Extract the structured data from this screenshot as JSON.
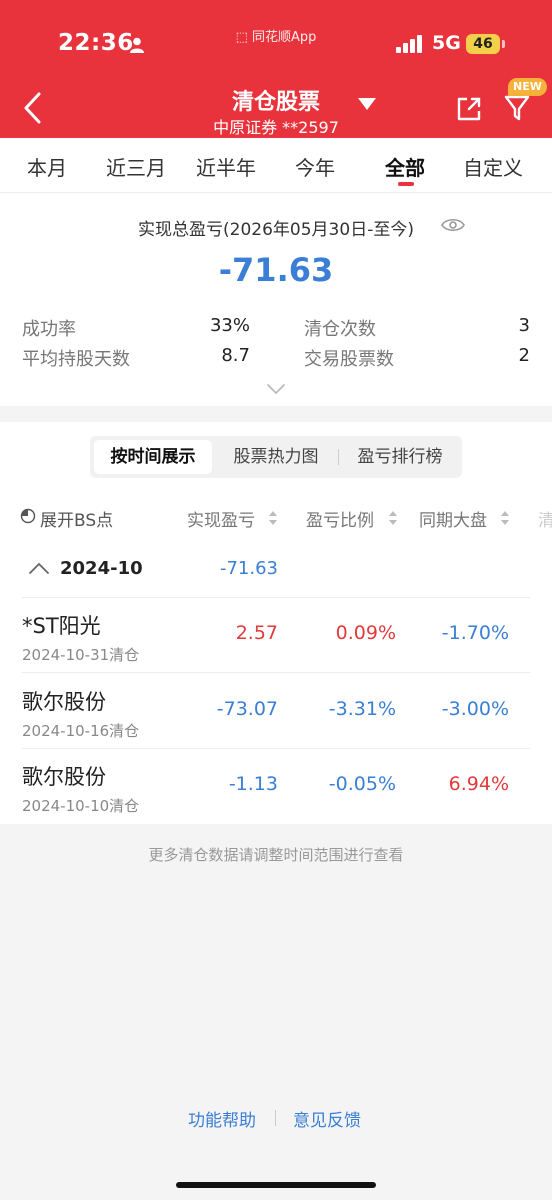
{
  "status_bar": {
    "time": "22:36",
    "carrier": "同花顺App",
    "network": "5G",
    "battery": "46"
  },
  "header": {
    "title": "清仓股票",
    "subtitle": "中原证券 **2597",
    "new_badge": "NEW"
  },
  "period_tabs": [
    {
      "label": "本月"
    },
    {
      "label": "近三月"
    },
    {
      "label": "近半年"
    },
    {
      "label": "今年"
    },
    {
      "label": "全部",
      "active": true
    },
    {
      "label": "自定义"
    }
  ],
  "summary": {
    "title": "实现总盈亏(2026年05月30日-至今)",
    "total_pl": "-71.63",
    "stats": [
      {
        "label": "成功率",
        "value": "33%"
      },
      {
        "label": "清仓次数",
        "value": "3"
      },
      {
        "label": "平均持股天数",
        "value": "8.7"
      },
      {
        "label": "交易股票数",
        "value": "2"
      }
    ]
  },
  "view_tabs": [
    {
      "label": "按时间展示",
      "active": true
    },
    {
      "label": "股票热力图"
    },
    {
      "label": "盈亏排行榜"
    }
  ],
  "columns": {
    "bs": "展开BS点",
    "realized": "实现盈亏",
    "ratio": "盈亏比例",
    "market": "同期大盘",
    "extra": "清"
  },
  "group": {
    "label": "2024-10",
    "pl": "-71.63"
  },
  "rows": [
    {
      "name": "*ST阳光",
      "date": "2024-10-31清仓",
      "pl": "2.57",
      "ratio": "0.09%",
      "market": "-1.70%",
      "pl_color": "red",
      "ratio_color": "red",
      "market_color": "blue"
    },
    {
      "name": "歌尔股份",
      "date": "2024-10-16清仓",
      "pl": "-73.07",
      "ratio": "-3.31%",
      "market": "-3.00%",
      "pl_color": "blue",
      "ratio_color": "blue",
      "market_color": "blue"
    },
    {
      "name": "歌尔股份",
      "date": "2024-10-10清仓",
      "pl": "-1.13",
      "ratio": "-0.05%",
      "market": "6.94%",
      "pl_color": "blue",
      "ratio_color": "blue",
      "market_color": "red"
    }
  ],
  "footer": {
    "note": "更多清仓数据请调整时间范围进行查看",
    "help": "功能帮助",
    "feedback": "意见反馈"
  },
  "colors": {
    "brand_red": "#e8333c",
    "gain_red": "#e23a3a",
    "loss_blue": "#3a7fd5"
  }
}
